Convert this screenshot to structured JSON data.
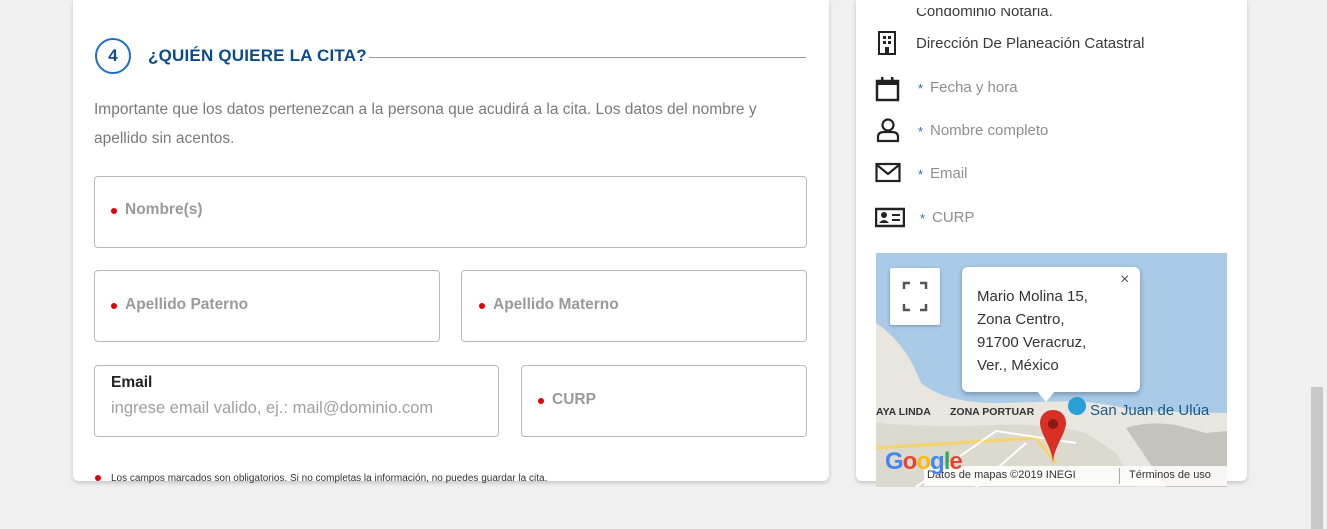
{
  "section": {
    "step_number": "4",
    "title": "¿QUIÉN QUIERE LA CITA?",
    "intro": "Importante que los datos pertenezcan a la persona que acudirá a la cita. Los datos del nombre y apellido sin acentos."
  },
  "form": {
    "nombre_label": "Nombre(s)",
    "apellido_paterno_label": "Apellido Paterno",
    "apellido_materno_label": "Apellido Materno",
    "email_label": "Email",
    "email_placeholder": "ingrese email valido, ej.: mail@dominio.com",
    "curp_label": "CURP",
    "footnote": "Los campos marcados son obligatorios. Si no completas la información, no puedes guardar la cita."
  },
  "summary": {
    "partial_top": "Condominio Notaria.",
    "office": "Dirección De Planeación Catastral",
    "date_time": "Fecha y hora",
    "full_name": "Nombre completo",
    "email": "Email",
    "curp": "CURP",
    "star": "*"
  },
  "map": {
    "popup_lines": [
      "Mario Molina 15,",
      "Zona Centro,",
      "91700 Veracruz,",
      "Ver., México"
    ],
    "close": "×",
    "label_aya_linda": "AYA LINDA",
    "label_zona_portuaria": "ZONA PORTUAR",
    "place": "San Juan de Ulúa",
    "google": "Google",
    "attribution": "Datos de mapas ©2019 INEGI",
    "terms": "Términos de uso"
  },
  "colors": {
    "accent": "#0b4a8b",
    "required": "#e0000a",
    "map_pin": "#d93025"
  }
}
